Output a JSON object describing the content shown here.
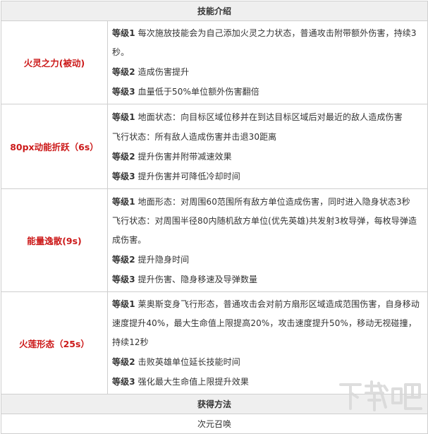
{
  "headers": {
    "skills": "技能介绍",
    "method": "获得方法"
  },
  "skills": [
    {
      "name": "火灵之力(被动)",
      "lines": [
        {
          "level": "等级1",
          "text": "每次施放技能会为自己添加火灵之力状态，普通攻击附带额外伤害，持续3秒。"
        },
        {
          "level": "等级2",
          "text": "造成伤害提升"
        },
        {
          "level": "等级3",
          "text": "血量低于50%单位额外伤害翻倍"
        }
      ]
    },
    {
      "name": "80px动能折跃（6s）",
      "lines": [
        {
          "level": "等级1",
          "text": "地面状态：向目标区域位移并在到达目标区域后对最近的敌人造成伤害"
        },
        {
          "level": "",
          "text": "飞行状态：所有敌人造成伤害并击退30距离"
        },
        {
          "level": "等级2",
          "text": "提升伤害并附带减速效果"
        },
        {
          "level": "等级3",
          "text": "提升伤害并可降低冷却时间"
        }
      ]
    },
    {
      "name": "能量逸散(9s)",
      "lines": [
        {
          "level": "等级1",
          "text": "地面形态：对周围60范围所有敌方单位造成伤害，同时进入隐身状态3秒"
        },
        {
          "level": "",
          "text": "飞行状态：对周围半径80内随机敌方单位(优先英雄)共发射3枚导弹，每枚导弹造成伤害。"
        },
        {
          "level": "等级2",
          "text": "提升隐身时间"
        },
        {
          "level": "等级3",
          "text": "提升伤害、隐身移速及导弹数量"
        }
      ]
    },
    {
      "name": "火莲形态（25s）",
      "lines": [
        {
          "level": "等级1",
          "text": "莱奥斯变身飞行形态，普通攻击会对前方扇形区域造成范围伤害，自身移动速度提升40%，最大生命值上限提高20%，攻击速度提升50%，移动无视碰撞，持续12秒"
        },
        {
          "level": "等级2",
          "text": "击败英雄单位延长技能时间"
        },
        {
          "level": "等级3",
          "text": "强化最大生命值上限提升效果"
        }
      ]
    }
  ],
  "method": {
    "value": "次元召唤"
  },
  "watermark": {
    "text": "下载吧",
    "url": "www.xiazaiba.com"
  },
  "colors": {
    "skill_name": "#cc1a1a",
    "header_bg": "#efefef",
    "border": "#cfcfcf",
    "text": "#333333"
  }
}
